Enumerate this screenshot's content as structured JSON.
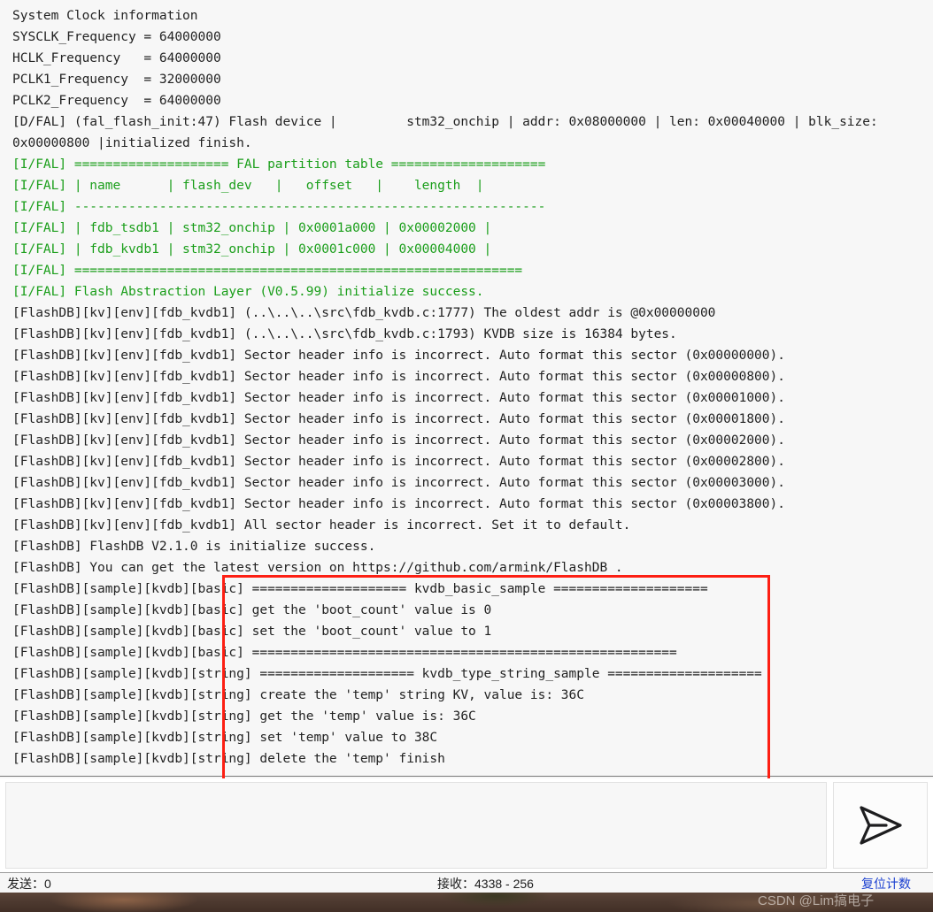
{
  "log": {
    "lines": [
      {
        "text": "System Clock information",
        "color": "default"
      },
      {
        "text": "SYSCLK_Frequency = 64000000",
        "color": "default"
      },
      {
        "text": "HCLK_Frequency   = 64000000",
        "color": "default"
      },
      {
        "text": "PCLK1_Frequency  = 32000000",
        "color": "default"
      },
      {
        "text": "PCLK2_Frequency  = 64000000",
        "color": "default"
      },
      {
        "text": "[D/FAL] (fal_flash_init:47) Flash device |         stm32_onchip | addr: 0x08000000 | len: 0x00040000 | blk_size:",
        "color": "default"
      },
      {
        "text": "0x00000800 |initialized finish.",
        "color": "default"
      },
      {
        "text": "[I/FAL] ==================== FAL partition table ====================",
        "color": "green"
      },
      {
        "text": "[I/FAL] | name      | flash_dev   |   offset   |    length  |",
        "color": "green"
      },
      {
        "text": "[I/FAL] -------------------------------------------------------------",
        "color": "green"
      },
      {
        "text": "[I/FAL] | fdb_tsdb1 | stm32_onchip | 0x0001a000 | 0x00002000 |",
        "color": "green"
      },
      {
        "text": "[I/FAL] | fdb_kvdb1 | stm32_onchip | 0x0001c000 | 0x00004000 |",
        "color": "green"
      },
      {
        "text": "[I/FAL] ==========================================================",
        "color": "green"
      },
      {
        "text": "[I/FAL] Flash Abstraction Layer (V0.5.99) initialize success.",
        "color": "green"
      },
      {
        "text": "[FlashDB][kv][env][fdb_kvdb1] (..\\..\\..\\src\\fdb_kvdb.c:1777) The oldest addr is @0x00000000",
        "color": "default"
      },
      {
        "text": "[FlashDB][kv][env][fdb_kvdb1] (..\\..\\..\\src\\fdb_kvdb.c:1793) KVDB size is 16384 bytes.",
        "color": "default"
      },
      {
        "text": "[FlashDB][kv][env][fdb_kvdb1] Sector header info is incorrect. Auto format this sector (0x00000000).",
        "color": "default"
      },
      {
        "text": "[FlashDB][kv][env][fdb_kvdb1] Sector header info is incorrect. Auto format this sector (0x00000800).",
        "color": "default"
      },
      {
        "text": "[FlashDB][kv][env][fdb_kvdb1] Sector header info is incorrect. Auto format this sector (0x00001000).",
        "color": "default"
      },
      {
        "text": "[FlashDB][kv][env][fdb_kvdb1] Sector header info is incorrect. Auto format this sector (0x00001800).",
        "color": "default"
      },
      {
        "text": "[FlashDB][kv][env][fdb_kvdb1] Sector header info is incorrect. Auto format this sector (0x00002000).",
        "color": "default"
      },
      {
        "text": "[FlashDB][kv][env][fdb_kvdb1] Sector header info is incorrect. Auto format this sector (0x00002800).",
        "color": "default"
      },
      {
        "text": "[FlashDB][kv][env][fdb_kvdb1] Sector header info is incorrect. Auto format this sector (0x00003000).",
        "color": "default"
      },
      {
        "text": "[FlashDB][kv][env][fdb_kvdb1] Sector header info is incorrect. Auto format this sector (0x00003800).",
        "color": "default"
      },
      {
        "text": "[FlashDB][kv][env][fdb_kvdb1] All sector header is incorrect. Set it to default.",
        "color": "default"
      },
      {
        "text": "[FlashDB] FlashDB V2.1.0 is initialize success.",
        "color": "default"
      },
      {
        "text": "[FlashDB] You can get the latest version on https://github.com/armink/FlashDB .",
        "color": "default"
      },
      {
        "text": "[FlashDB][sample][kvdb][basic] ==================== kvdb_basic_sample ====================",
        "color": "default"
      },
      {
        "text": "[FlashDB][sample][kvdb][basic] get the 'boot_count' value is 0",
        "color": "default"
      },
      {
        "text": "[FlashDB][sample][kvdb][basic] set the 'boot_count' value to 1",
        "color": "default"
      },
      {
        "text": "[FlashDB][sample][kvdb][basic] =======================================================",
        "color": "default"
      },
      {
        "text": "[FlashDB][sample][kvdb][string] ==================== kvdb_type_string_sample ====================",
        "color": "default"
      },
      {
        "text": "[FlashDB][sample][kvdb][string] create the 'temp' string KV, value is: 36C",
        "color": "default"
      },
      {
        "text": "[FlashDB][sample][kvdb][string] get the 'temp' value is: 36C",
        "color": "default"
      },
      {
        "text": "[FlashDB][sample][kvdb][string] set 'temp' value to 38C",
        "color": "default"
      },
      {
        "text": "[FlashDB][sample][kvdb][string] delete the 'temp' finish",
        "color": "default"
      }
    ]
  },
  "annotation": {
    "color": "#fd1f13"
  },
  "send_panel": {
    "input_value": "",
    "input_placeholder": "",
    "button_icon": "send-arrow-icon"
  },
  "status_bar": {
    "send_label": "发送：0",
    "receive_label": "接收：4338 - 256",
    "reset_counter_label": "复位计数",
    "link_color": "#1a3fd0"
  },
  "watermark": {
    "text": "CSDN @Lim搞电子"
  }
}
